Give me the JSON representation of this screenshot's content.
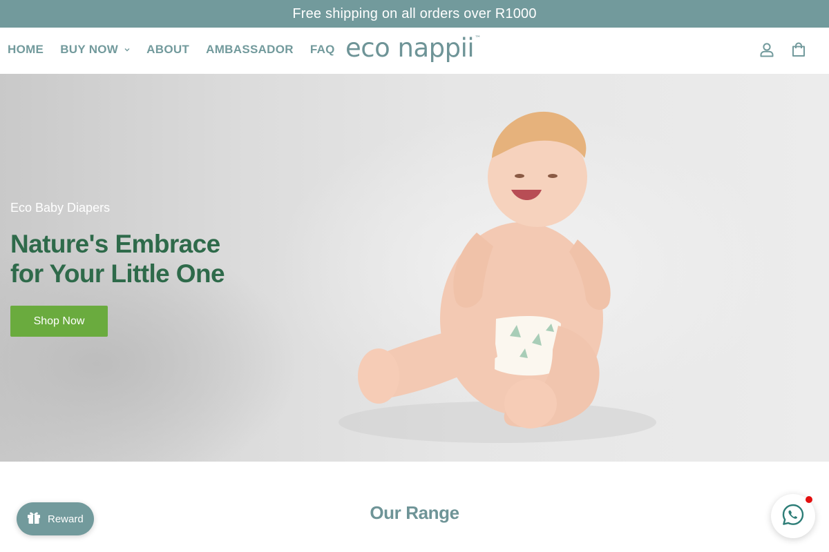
{
  "announcement": {
    "text": "Free shipping on all orders over R1000"
  },
  "header": {
    "nav": [
      {
        "label": "HOME"
      },
      {
        "label": "BUY NOW"
      },
      {
        "label": "ABOUT"
      },
      {
        "label": "AMBASSADOR"
      },
      {
        "label": "FAQ"
      }
    ],
    "logo": {
      "text": "eco nappii",
      "tm": "™"
    },
    "icons": [
      "account-icon",
      "cart-icon"
    ]
  },
  "hero": {
    "eyebrow": "Eco Baby Diapers",
    "title_line1": "Nature's Embrace",
    "title_line2": "for Your Little One",
    "cta": "Shop Now"
  },
  "range": {
    "title": "Our Range"
  },
  "reward": {
    "label": "Reward",
    "icon": "gift-icon"
  },
  "chat": {
    "icon": "whatsapp-icon"
  },
  "colors": {
    "brand_teal": "#729a9c",
    "headline_green": "#2e6a4a",
    "cta_green": "#6aab3e",
    "notification_red": "#e40f0f"
  }
}
